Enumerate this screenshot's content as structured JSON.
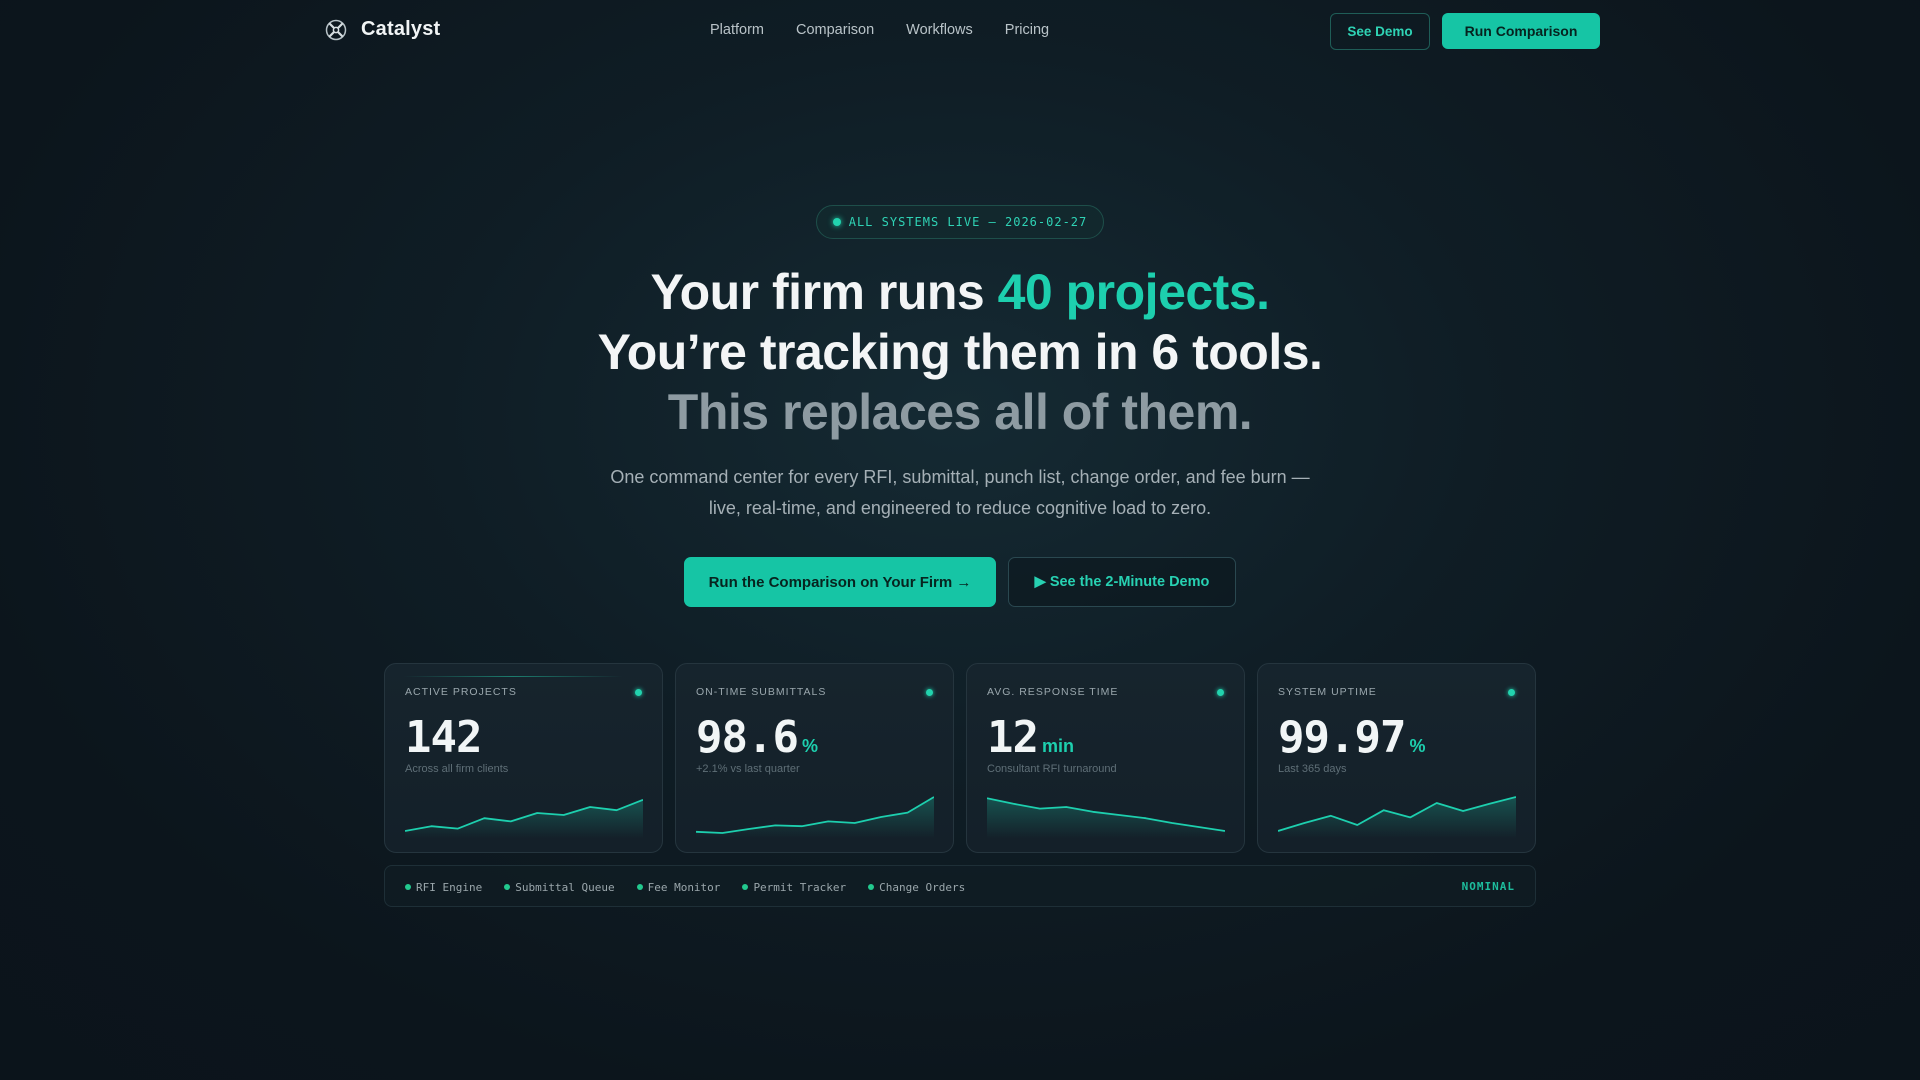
{
  "brand": {
    "name": "Catalyst",
    "logo_icon": "catalyst-logo-icon"
  },
  "nav": {
    "links": [
      "Platform",
      "Comparison",
      "Workflows",
      "Pricing"
    ],
    "see_demo": "See Demo",
    "run_comparison": "Run Comparison"
  },
  "hero": {
    "status": "ALL SYSTEMS LIVE — 2026-02-27",
    "line1_a": "Your firm runs ",
    "line1_b": "40 projects.",
    "line2": "You’re tracking them in 6 tools.",
    "line3": "This replaces all of them.",
    "subtext": "One command center for every RFI, submittal, punch list, change order, and fee burn — live, real-time, and engineered to reduce cognitive load to zero.",
    "cta_primary": "Run the Comparison on Your Firm →",
    "cta_secondary": "▶ See the 2-Minute Demo"
  },
  "metrics": [
    {
      "label": "ACTIVE PROJECTS",
      "value": "142",
      "unit": "",
      "sub": "Across all firm clients",
      "trend": [
        0.1,
        0.22,
        0.16,
        0.42,
        0.34,
        0.55,
        0.5,
        0.7,
        0.62,
        0.88
      ]
    },
    {
      "label": "ON-TIME SUBMITTALS",
      "value": "98.6",
      "unit": "%",
      "sub": "+2.1% vs last quarter",
      "trend": [
        0.08,
        0.05,
        0.15,
        0.24,
        0.22,
        0.34,
        0.3,
        0.45,
        0.56,
        0.95
      ]
    },
    {
      "label": "AVG. RESPONSE TIME",
      "value": "12",
      "unit": "min",
      "sub": "Consultant RFI turnaround",
      "trend": [
        0.92,
        0.78,
        0.66,
        0.7,
        0.58,
        0.5,
        0.42,
        0.3,
        0.2,
        0.1
      ]
    },
    {
      "label": "SYSTEM UPTIME",
      "value": "99.97",
      "unit": "%",
      "sub": "Last 365 days",
      "trend": [
        0.1,
        0.3,
        0.48,
        0.25,
        0.62,
        0.44,
        0.8,
        0.6,
        0.78,
        0.95
      ]
    }
  ],
  "systems": {
    "items": [
      "RFI Engine",
      "Submittal Queue",
      "Fee Monitor",
      "Permit Tracker",
      "Change Orders"
    ],
    "state": "NOMINAL"
  },
  "colors": {
    "accent": "#16c5a5",
    "background": "#0d1820",
    "card": "#15222b",
    "status_green": "#22c98e"
  }
}
